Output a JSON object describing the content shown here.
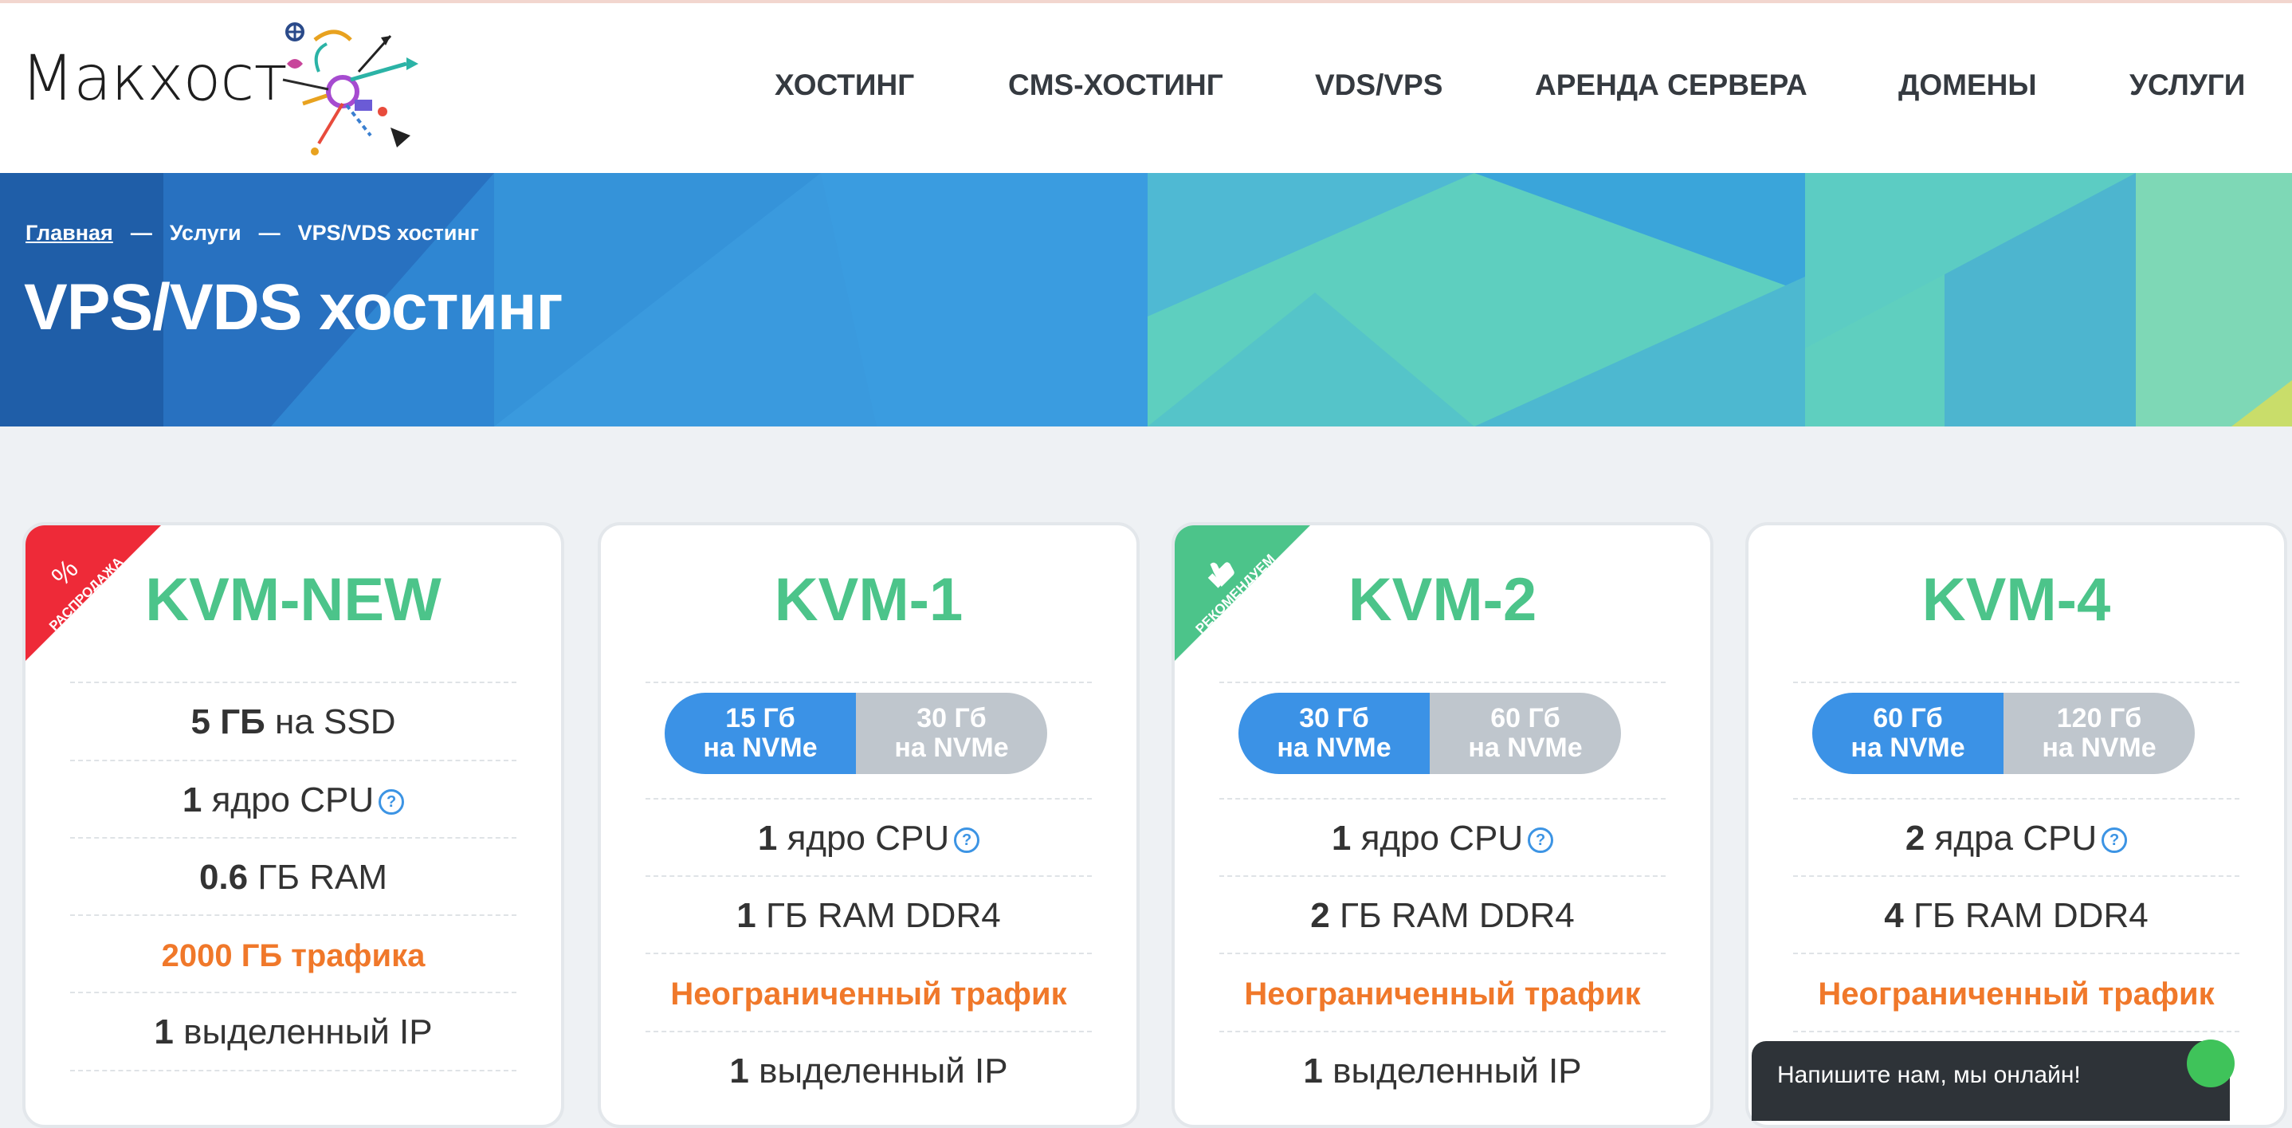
{
  "brand": {
    "name": "Макхост"
  },
  "nav": [
    "ХОСТИНГ",
    "CMS-ХОСТИНГ",
    "VDS/VPS",
    "АРЕНДА СЕРВЕРА",
    "ДОМЕНЫ",
    "УСЛУГИ"
  ],
  "breadcrumb": {
    "home": "Главная",
    "sep": "—",
    "services": "Услуги",
    "current": "VPS/VDS хостинг"
  },
  "page_title": "VPS/VDS хостинг",
  "colors": {
    "accent_green": "#4cc48a",
    "accent_blue": "#3b92e6",
    "accent_orange": "#f0782a",
    "sale_red": "#ee2a38"
  },
  "plans": [
    {
      "name": "KVM-NEW",
      "ribbon": "РАСПРОДАЖА",
      "ribbon_icon": "%",
      "storage": {
        "value": "5 ГБ",
        "unit": "на SSD"
      },
      "cpu": {
        "value": "1",
        "unit": "ядро CPU"
      },
      "ram": {
        "value": "0.6",
        "unit": "ГБ RAM"
      },
      "traffic": "2000 ГБ трафика",
      "ip": {
        "value": "1",
        "unit": "выделенный IP"
      }
    },
    {
      "name": "KVM-1",
      "storage_options": [
        {
          "size": "15 Гб",
          "type": "на NVMe"
        },
        {
          "size": "30 Гб",
          "type": "на NVMe"
        }
      ],
      "cpu": {
        "value": "1",
        "unit": "ядро CPU"
      },
      "ram": {
        "value": "1",
        "unit": "ГБ RAM DDR4"
      },
      "traffic": "Неограниченный трафик",
      "ip": {
        "value": "1",
        "unit": "выделенный IP"
      }
    },
    {
      "name": "KVM-2",
      "ribbon": "РЕКОМЕНДУЕМ",
      "storage_options": [
        {
          "size": "30 Гб",
          "type": "на NVMe"
        },
        {
          "size": "60 Гб",
          "type": "на NVMe"
        }
      ],
      "cpu": {
        "value": "1",
        "unit": "ядро CPU"
      },
      "ram": {
        "value": "2",
        "unit": "ГБ RAM DDR4"
      },
      "traffic": "Неограниченный трафик",
      "ip": {
        "value": "1",
        "unit": "выделенный IP"
      }
    },
    {
      "name": "KVM-4",
      "storage_options": [
        {
          "size": "60 Гб",
          "type": "на NVMe"
        },
        {
          "size": "120 Гб",
          "type": "на NVMe"
        }
      ],
      "cpu": {
        "value": "2",
        "unit": "ядра CPU"
      },
      "ram": {
        "value": "4",
        "unit": "ГБ RAM DDR4"
      },
      "traffic": "Неограниченный трафик"
    }
  ],
  "help_glyph": "?",
  "chat": {
    "label": "Напишите нам, мы онлайн!"
  }
}
